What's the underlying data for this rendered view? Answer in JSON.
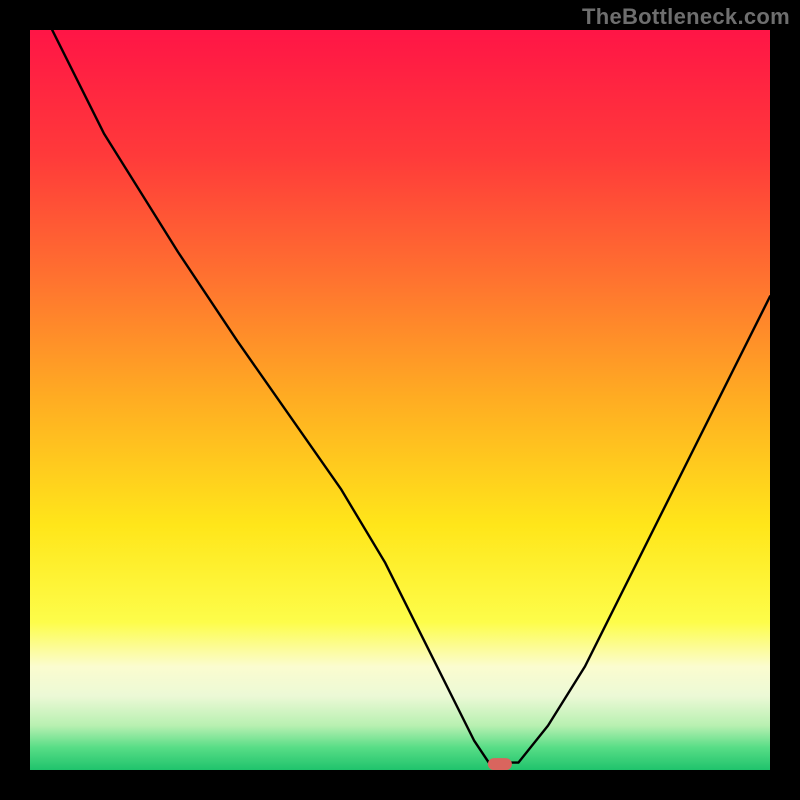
{
  "watermark": "TheBottleneck.com",
  "chart_data": {
    "type": "line",
    "title": "",
    "xlabel": "",
    "ylabel": "",
    "xlim": [
      0,
      100
    ],
    "ylim": [
      0,
      100
    ],
    "series": [
      {
        "name": "bottleneck-curve",
        "x": [
          3,
          10,
          20,
          28,
          35,
          42,
          48,
          53,
          57,
          60,
          62,
          66,
          70,
          75,
          80,
          85,
          90,
          95,
          100
        ],
        "values": [
          100,
          86,
          70,
          58,
          48,
          38,
          28,
          18,
          10,
          4,
          1,
          1,
          6,
          14,
          24,
          34,
          44,
          54,
          64
        ]
      }
    ],
    "annotations": [
      {
        "name": "optimal-marker",
        "x": 63.5,
        "y": 0.8,
        "shape": "pill"
      }
    ],
    "gradient_stops": [
      {
        "offset": 0.0,
        "color": "#ff1546"
      },
      {
        "offset": 0.17,
        "color": "#ff3a3a"
      },
      {
        "offset": 0.33,
        "color": "#ff7030"
      },
      {
        "offset": 0.5,
        "color": "#ffad22"
      },
      {
        "offset": 0.67,
        "color": "#ffe61a"
      },
      {
        "offset": 0.8,
        "color": "#fdfd4a"
      },
      {
        "offset": 0.86,
        "color": "#fbfccf"
      },
      {
        "offset": 0.9,
        "color": "#ecf9d6"
      },
      {
        "offset": 0.94,
        "color": "#b8f0b1"
      },
      {
        "offset": 0.97,
        "color": "#57dd86"
      },
      {
        "offset": 1.0,
        "color": "#1fc36c"
      }
    ]
  }
}
